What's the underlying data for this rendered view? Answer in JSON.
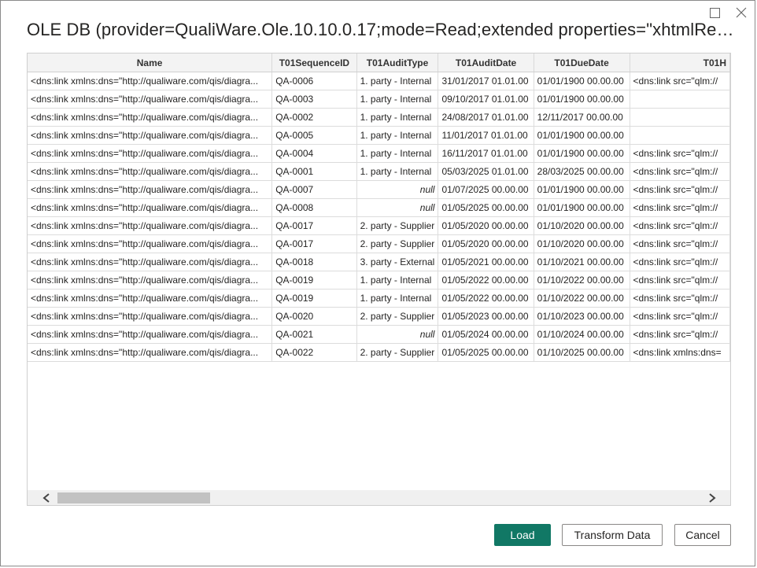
{
  "window": {
    "title": "OLE DB (provider=QualiWare.Ole.10.10.0.17;mode=Read;extended properties=\"xhtmlRes...",
    "controls": [
      "maximize-icon",
      "close-icon"
    ]
  },
  "table": {
    "columns": [
      "Name",
      "T01SequenceID",
      "T01AuditType",
      "T01AuditDate",
      "T01DueDate",
      "T01H"
    ],
    "rows": [
      [
        "<dns:link xmlns:dns=\"http://qualiware.com/qis/diagra...",
        "QA-0006",
        "1. party - Internal",
        "31/01/2017 01.01.00",
        "01/01/1900 00.00.00",
        "<dns:link src=\"qlm://"
      ],
      [
        "<dns:link xmlns:dns=\"http://qualiware.com/qis/diagra...",
        "QA-0003",
        "1. party - Internal",
        "09/10/2017 01.01.00",
        "01/01/1900 00.00.00",
        ""
      ],
      [
        "<dns:link xmlns:dns=\"http://qualiware.com/qis/diagra...",
        "QA-0002",
        "1. party - Internal",
        "24/08/2017 01.01.00",
        "12/11/2017 00.00.00",
        ""
      ],
      [
        "<dns:link xmlns:dns=\"http://qualiware.com/qis/diagra...",
        "QA-0005",
        "1. party - Internal",
        "11/01/2017 01.01.00",
        "01/01/1900 00.00.00",
        ""
      ],
      [
        "<dns:link xmlns:dns=\"http://qualiware.com/qis/diagra...",
        "QA-0004",
        "1. party - Internal",
        "16/11/2017 01.01.00",
        "01/01/1900 00.00.00",
        "<dns:link src=\"qlm://"
      ],
      [
        "<dns:link xmlns:dns=\"http://qualiware.com/qis/diagra...",
        "QA-0001",
        "1. party - Internal",
        "05/03/2025 01.01.00",
        "28/03/2025 00.00.00",
        "<dns:link src=\"qlm://"
      ],
      [
        "<dns:link xmlns:dns=\"http://qualiware.com/qis/diagra...",
        "QA-0007",
        "null",
        "01/07/2025 00.00.00",
        "01/01/1900 00.00.00",
        "<dns:link src=\"qlm://"
      ],
      [
        "<dns:link xmlns:dns=\"http://qualiware.com/qis/diagra...",
        "QA-0008",
        "null",
        "01/05/2025 00.00.00",
        "01/01/1900 00.00.00",
        "<dns:link src=\"qlm://"
      ],
      [
        "<dns:link xmlns:dns=\"http://qualiware.com/qis/diagra...",
        "QA-0017",
        "2. party - Supplier",
        "01/05/2020 00.00.00",
        "01/10/2020 00.00.00",
        "<dns:link src=\"qlm://"
      ],
      [
        "<dns:link xmlns:dns=\"http://qualiware.com/qis/diagra...",
        "QA-0017",
        "2. party - Supplier",
        "01/05/2020 00.00.00",
        "01/10/2020 00.00.00",
        "<dns:link src=\"qlm://"
      ],
      [
        "<dns:link xmlns:dns=\"http://qualiware.com/qis/diagra...",
        "QA-0018",
        "3. party - External",
        "01/05/2021 00.00.00",
        "01/10/2021 00.00.00",
        "<dns:link src=\"qlm://"
      ],
      [
        "<dns:link xmlns:dns=\"http://qualiware.com/qis/diagra...",
        "QA-0019",
        "1. party - Internal",
        "01/05/2022 00.00.00",
        "01/10/2022 00.00.00",
        "<dns:link src=\"qlm://"
      ],
      [
        "<dns:link xmlns:dns=\"http://qualiware.com/qis/diagra...",
        "QA-0019",
        "1. party - Internal",
        "01/05/2022 00.00.00",
        "01/10/2022 00.00.00",
        "<dns:link src=\"qlm://"
      ],
      [
        "<dns:link xmlns:dns=\"http://qualiware.com/qis/diagra...",
        "QA-0020",
        "2. party - Supplier",
        "01/05/2023 00.00.00",
        "01/10/2023 00.00.00",
        "<dns:link src=\"qlm://"
      ],
      [
        "<dns:link xmlns:dns=\"http://qualiware.com/qis/diagra...",
        "QA-0021",
        "null",
        "01/05/2024 00.00.00",
        "01/10/2024 00.00.00",
        "<dns:link src=\"qlm://"
      ],
      [
        "<dns:link xmlns:dns=\"http://qualiware.com/qis/diagra...",
        "QA-0022",
        "2. party - Supplier",
        "01/05/2025 00.00.00",
        "01/10/2025 00.00.00",
        "<dns:link xmlns:dns="
      ]
    ]
  },
  "scrollbar": {
    "left_icon": "chevron-left-icon",
    "right_icon": "chevron-right-icon"
  },
  "buttons": {
    "load": "Load",
    "transform": "Transform Data",
    "cancel": "Cancel"
  },
  "colors": {
    "primary": "#117865"
  }
}
